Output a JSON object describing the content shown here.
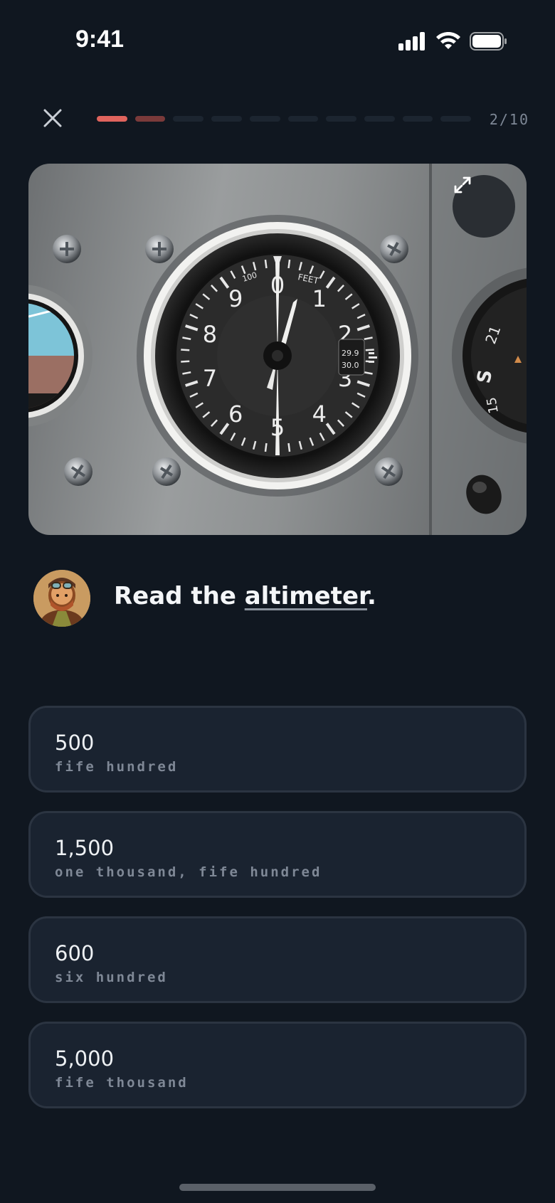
{
  "status_bar": {
    "time": "9:41"
  },
  "lesson": {
    "progress_count": "2/10",
    "progress_done": 1,
    "progress_partial": 1,
    "progress_total": 10
  },
  "instrument": {
    "dial_label": "FEET",
    "dial_sub_label": "100",
    "dial_numbers": [
      "0",
      "1",
      "2",
      "3",
      "4",
      "5",
      "6",
      "7",
      "8",
      "9"
    ],
    "kollsman_values": [
      "29.9",
      "30.0"
    ]
  },
  "question": {
    "prefix": "Read the ",
    "term": "altimeter",
    "suffix": "."
  },
  "options": [
    {
      "value": "500",
      "words": "fife hundred"
    },
    {
      "value": "1,500",
      "words": "one thousand, fife hundred"
    },
    {
      "value": "600",
      "words": "six hundred"
    },
    {
      "value": "5,000",
      "words": "fife thousand"
    }
  ],
  "colors": {
    "background": "#101720",
    "accent": "#e0645d",
    "option_bg": "#1a2330",
    "option_border": "#2b3441"
  }
}
